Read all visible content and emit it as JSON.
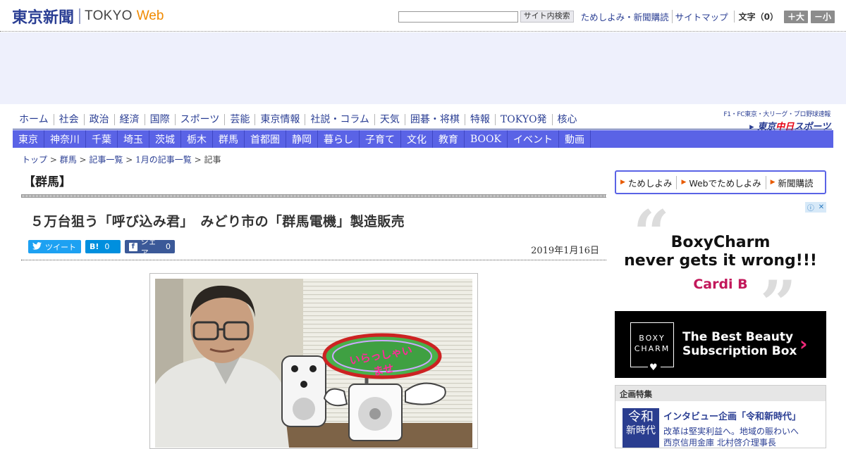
{
  "header": {
    "logo_jp": "東京新聞",
    "logo_en": "TOKYO",
    "logo_web": "Web",
    "search_placeholder": "",
    "search_button": "サイト内検索",
    "links": [
      "ためしよみ・新聞購読",
      "サイトマップ"
    ],
    "font_size_label": "文字（0）",
    "font_up": "＋大",
    "font_down": "－小"
  },
  "nav": {
    "main": [
      "ホーム",
      "社会",
      "政治",
      "経済",
      "国際",
      "スポーツ",
      "芸能",
      "東京情報",
      "社説・コラム",
      "天気",
      "囲碁・将棋",
      "特報",
      "TOKYO発",
      "核心"
    ],
    "partner_tagline": "F1・FC東京・大リーグ・プロ野球速報",
    "partner_name_pre": "東京",
    "partner_name_mid": "中日",
    "partner_name_post": "スポーツ",
    "sub": [
      "東京",
      "神奈川",
      "千葉",
      "埼玉",
      "茨城",
      "栃木",
      "群馬",
      "首都圏",
      "静岡",
      "暮らし",
      "子育て",
      "文化",
      "教育",
      "BOOK",
      "イベント",
      "動画"
    ]
  },
  "breadcrumb": {
    "items": [
      "トップ",
      "群馬",
      "記事一覧",
      "1月の記事一覧"
    ],
    "current": "記事",
    "sep": " > "
  },
  "article": {
    "section": "【群馬】",
    "headline": "５万台狙う「呼び込み君」　みどり市の「群馬電機」製造販売",
    "tweet_label": "ツイート",
    "hatena_label": "B!",
    "hatena_count": "0",
    "fb_label": "シェア",
    "fb_count": "0",
    "date": "2019年1月16日",
    "photo_sign_text": "いらっしゃいませ"
  },
  "sidebar": {
    "promo_links": [
      "ためしよみ",
      "Webでためしよみ",
      "新聞購読"
    ],
    "ad": {
      "line1": "BoxyCharm",
      "line2": "never gets it wrong!!!",
      "signature": "Cardi B",
      "logo_line1": "BOXY",
      "logo_line2": "CHARM",
      "cta_line1": "The Best Beauty",
      "cta_line2": "Subscription Box"
    },
    "feature": {
      "heading": "企画特集",
      "thumb_line1": "令和",
      "thumb_line2": "新時代",
      "title": "インタビュー企画「令和新時代」",
      "desc_line1": "改革は堅実利益へ。地域の賑わいへ",
      "desc_line2": "西京信用金庫 北村啓介理事長"
    }
  },
  "colors": {
    "brand_navy": "#2b3f94",
    "brand_orange": "#f08a00",
    "subnav_bg": "#5a63e6",
    "ad_banner_bg": "#eef0fc",
    "twitter": "#1da1f2",
    "hatena": "#008fde",
    "facebook": "#3b5998"
  },
  "icons": {
    "twitter": "twitter-bird-icon",
    "facebook": "facebook-f-icon",
    "promo_bullet": "orange-triangle-icon",
    "ad_choices": "info-icon"
  }
}
